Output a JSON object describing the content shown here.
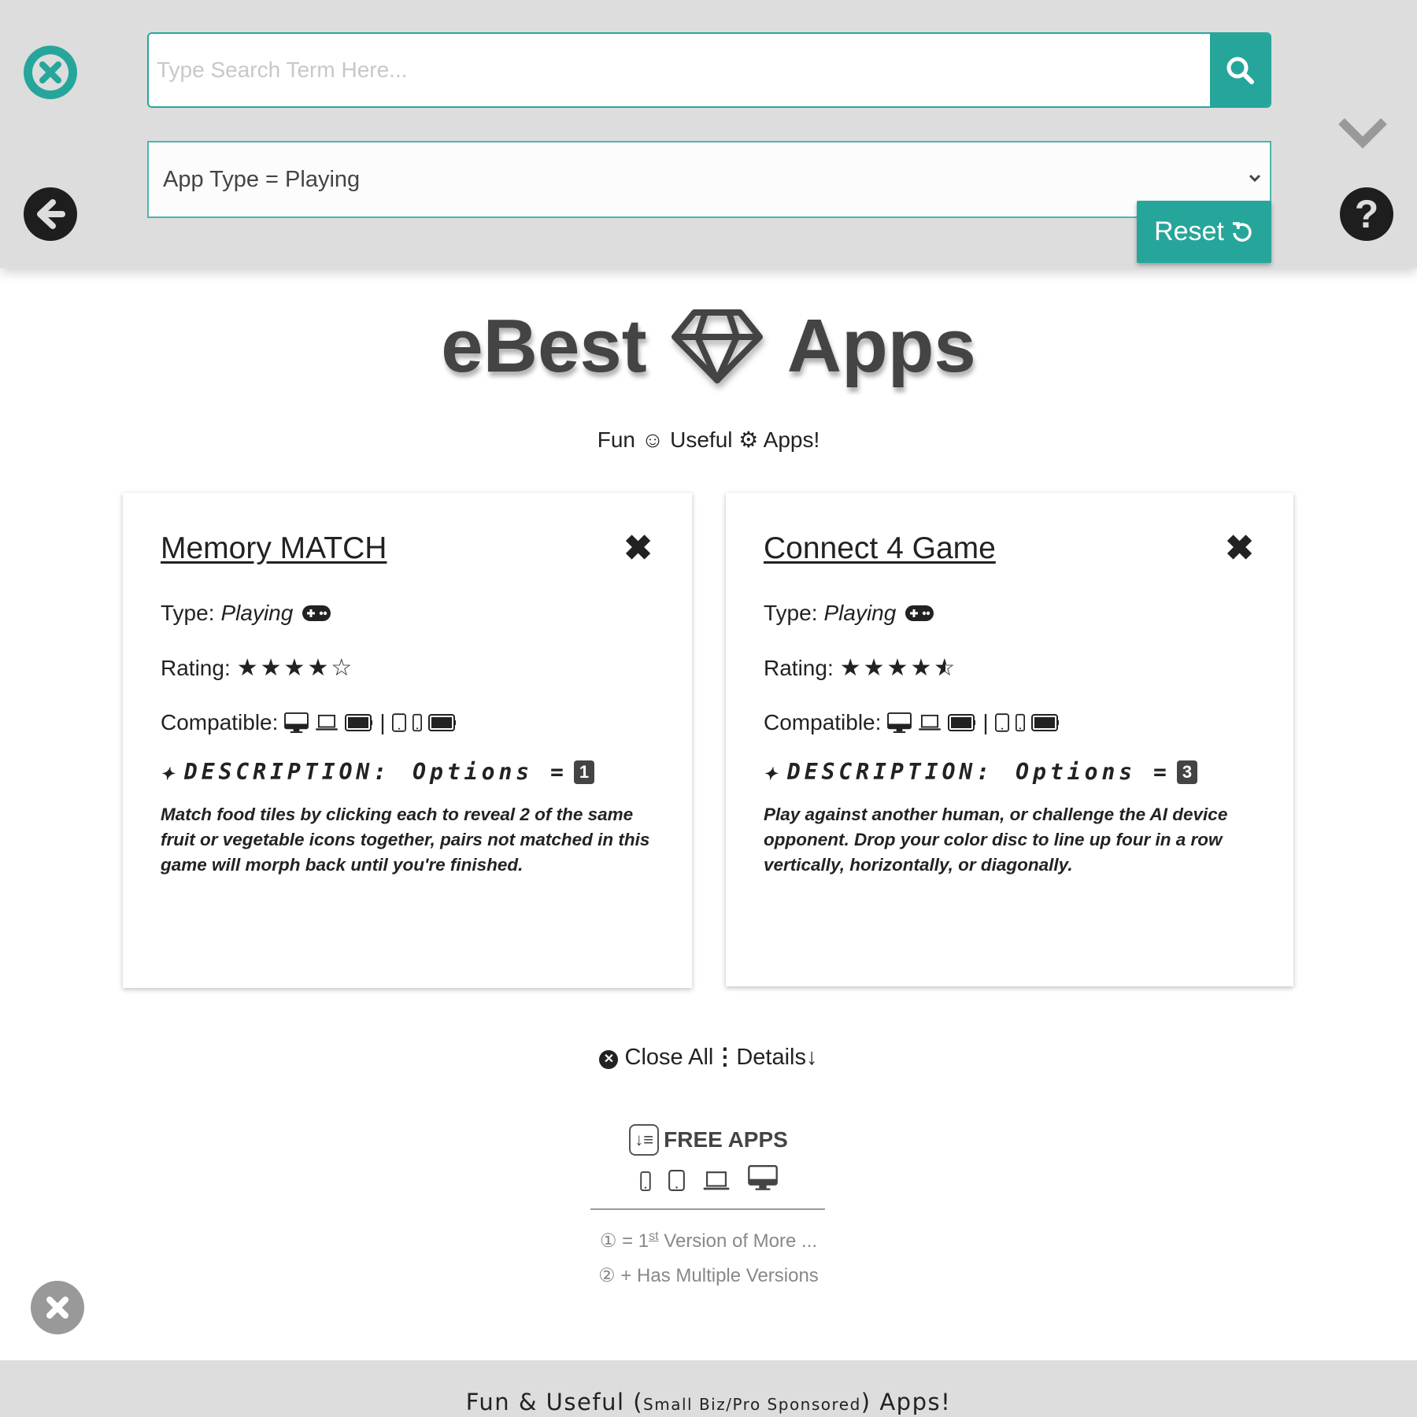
{
  "header": {
    "search_placeholder": "Type Search Term Here...",
    "search_value": "",
    "select_value": "App Type = Playing",
    "reset_label": "Reset",
    "accent_color": "#26a69a"
  },
  "brand": {
    "left": "eBest",
    "right": "Apps",
    "icon": "diamond-icon"
  },
  "tagline": {
    "fun": "Fun",
    "useful": "Useful",
    "apps": "Apps!"
  },
  "cards": [
    {
      "title": "Memory MATCH",
      "type_label": "Type:",
      "type_value": "Playing",
      "rating_label": "Rating:",
      "rating": 4,
      "rating_max": 5,
      "compatible_label": "Compatible:",
      "description_label": "DESCRIPTION:",
      "options_label": "Options =",
      "options_count": "1",
      "description": "Match food tiles by clicking each to reveal 2 of the same fruit or vegetable icons together, pairs not matched in this game will morph back until you're finished."
    },
    {
      "title": "Connect 4 Game",
      "type_label": "Type:",
      "type_value": "Playing",
      "rating_label": "Rating:",
      "rating": 4.5,
      "rating_max": 5,
      "compatible_label": "Compatible:",
      "description_label": "DESCRIPTION:",
      "options_label": "Options =",
      "options_count": "3",
      "description": "Play against another human, or challenge the AI device opponent. Drop your color disc to line up four in a row vertically, horizontally, or diagonally."
    }
  ],
  "actions": {
    "close_all": "Close All",
    "details": "Details"
  },
  "free_apps": {
    "label": "FREE APPS"
  },
  "notes": {
    "n1_symbol": "①",
    "n1_eq": "= 1",
    "n1_sup": "st",
    "n1_text": "Version of More ...",
    "n2_symbol": "②",
    "n2_text": "+ Has Multiple Versions"
  },
  "footer": {
    "left": "Fun & Useful (",
    "small": "Small Biz/Pro Sponsored",
    "right": ") Apps!"
  }
}
